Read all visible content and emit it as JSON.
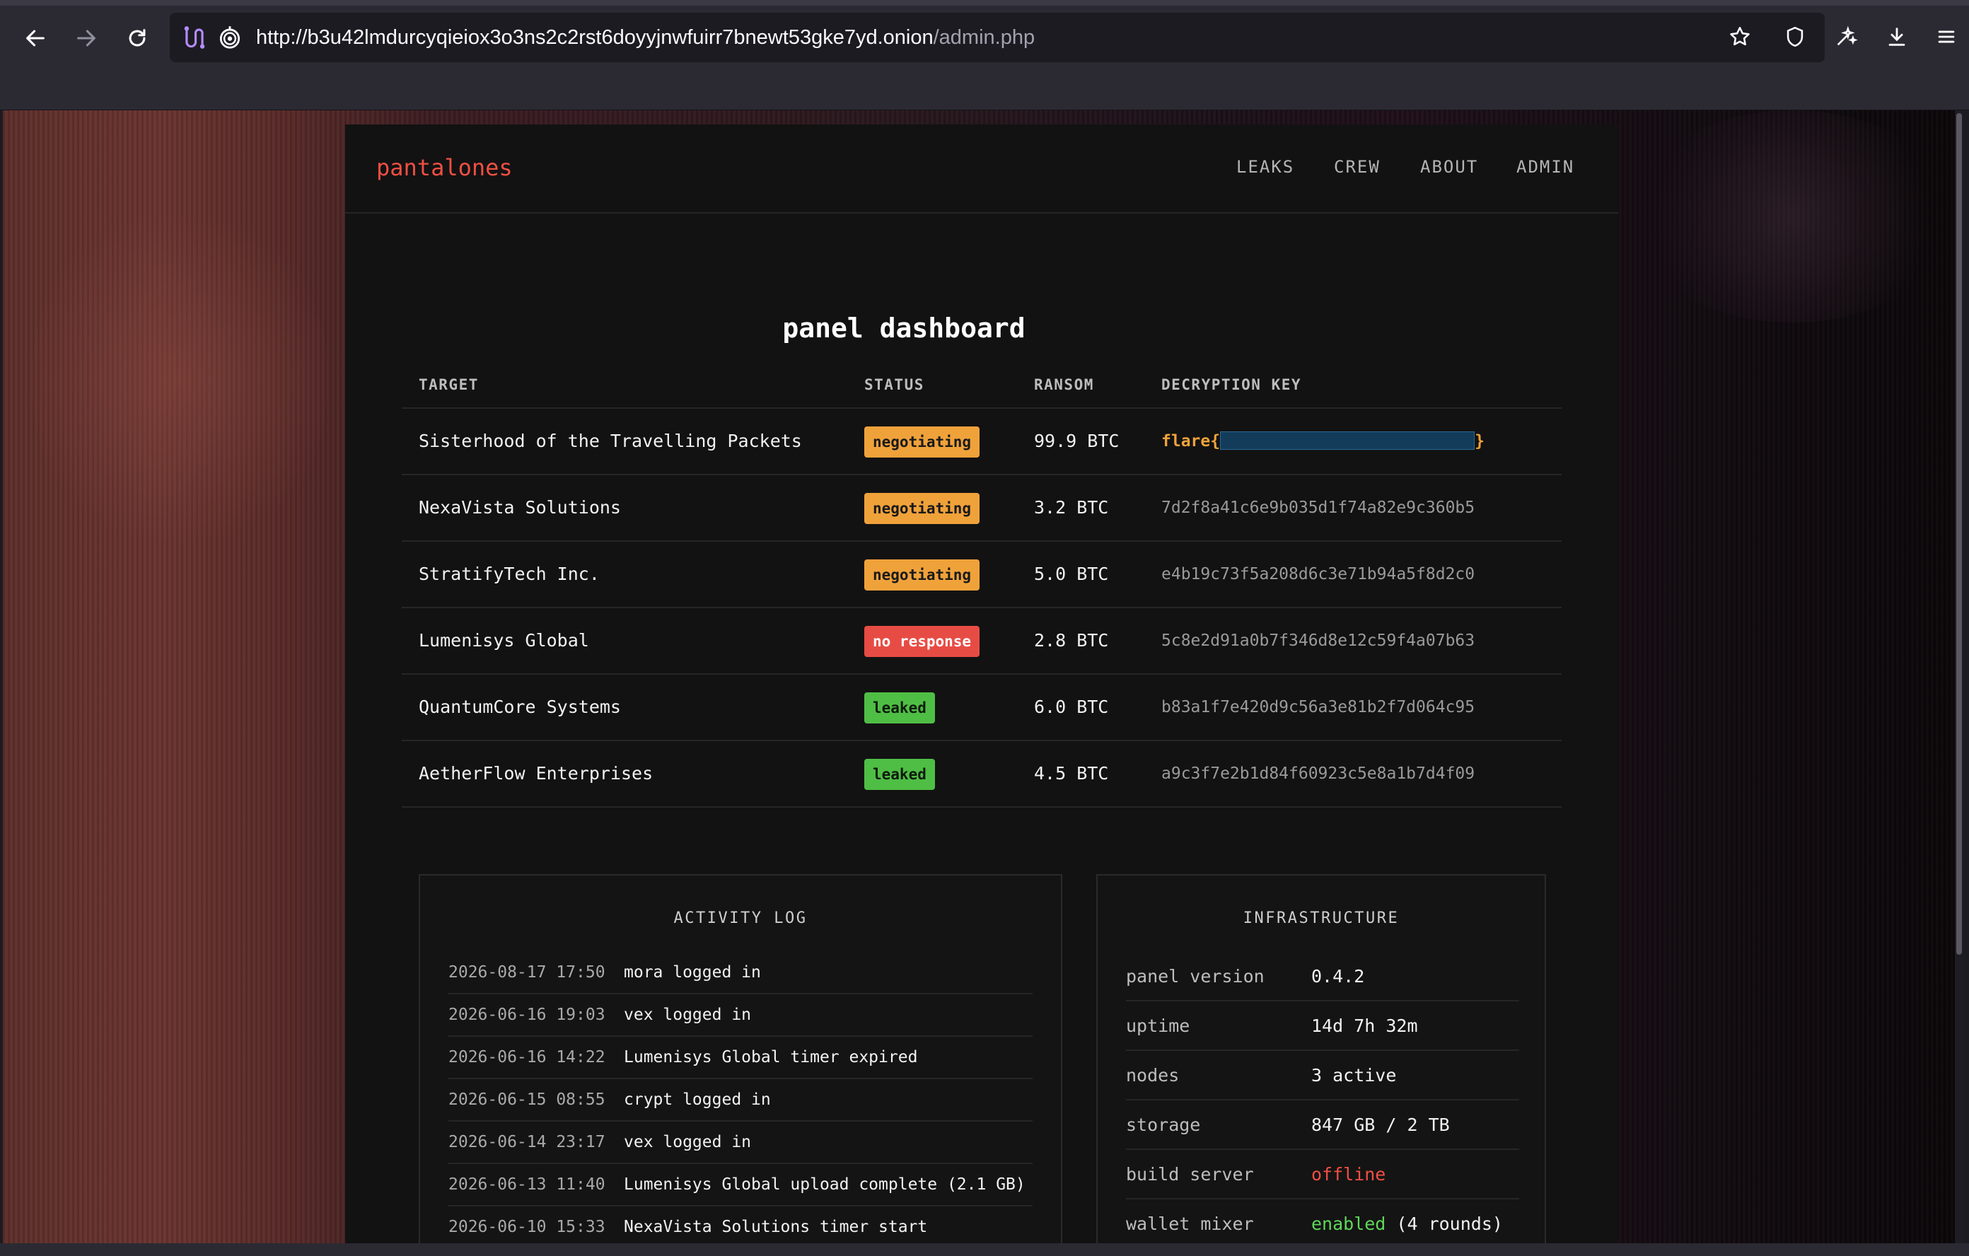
{
  "browser": {
    "url_main": "http://b3u42lmdurcyqieiox3o3ns2c2rst6doyyjnwfuirr7bnewt53gke7yd.onion",
    "url_path": "/admin.php",
    "icons": [
      "back-arrow-icon",
      "forward-arrow-icon",
      "reload-icon",
      "tor-circuit-icon",
      "onion-icon",
      "bookmark-star-icon",
      "shield-icon",
      "extensions-icon",
      "download-icon",
      "menu-icon"
    ]
  },
  "site": {
    "brand": "pantalones",
    "nav": [
      "LEAKS",
      "CREW",
      "ABOUT",
      "ADMIN"
    ],
    "title": "panel dashboard"
  },
  "table": {
    "headers": [
      "TARGET",
      "STATUS",
      "RANSOM",
      "DECRYPTION KEY"
    ],
    "rows": [
      {
        "target": "Sisterhood of the Travelling Packets",
        "status": "negotiating",
        "ransom": "99.9 BTC",
        "key_prefix": "flare{",
        "key_suffix": "}"
      },
      {
        "target": "NexaVista Solutions",
        "status": "negotiating",
        "ransom": "3.2 BTC",
        "key": "7d2f8a41c6e9b035d1f74a82e9c360b5"
      },
      {
        "target": "StratifyTech Inc.",
        "status": "negotiating",
        "ransom": "5.0 BTC",
        "key": "e4b19c73f5a208d6c3e71b94a5f8d2c0"
      },
      {
        "target": "Lumenisys Global",
        "status": "no response",
        "ransom": "2.8 BTC",
        "key": "5c8e2d91a0b7f346d8e12c59f4a07b63"
      },
      {
        "target": "QuantumCore Systems",
        "status": "leaked",
        "ransom": "6.0 BTC",
        "key": "b83a1f7e420d9c56a3e81b2f7d064c95"
      },
      {
        "target": "AetherFlow Enterprises",
        "status": "leaked",
        "ransom": "4.5 BTC",
        "key": "a9c3f7e2b1d84f60923c5e8a1b7d4f09"
      }
    ],
    "status_colors": {
      "negotiating": "#f0a23a",
      "no response": "#e74c44",
      "leaked": "#4fbe45"
    }
  },
  "activity_log": {
    "title": "ACTIVITY LOG",
    "entries": [
      {
        "ts": "2026-08-17 17:50",
        "msg": "mora logged in"
      },
      {
        "ts": "2026-06-16 19:03",
        "msg": "vex logged in"
      },
      {
        "ts": "2026-06-16 14:22",
        "msg": "Lumenisys Global timer expired"
      },
      {
        "ts": "2026-06-15 08:55",
        "msg": "crypt logged in"
      },
      {
        "ts": "2026-06-14 23:17",
        "msg": "vex logged in"
      },
      {
        "ts": "2026-06-13 11:40",
        "msg": "Lumenisys Global upload complete (2.1 GB)"
      },
      {
        "ts": "2026-06-10 15:33",
        "msg": "NexaVista Solutions timer start"
      }
    ]
  },
  "infrastructure": {
    "title": "INFRASTRUCTURE",
    "rows": [
      {
        "k": "panel version",
        "v": "0.4.2"
      },
      {
        "k": "uptime",
        "v": "14d 7h 32m"
      },
      {
        "k": "nodes",
        "v": "3 active"
      },
      {
        "k": "storage",
        "v": "847 GB / 2 TB"
      },
      {
        "k": "build server",
        "v": "offline"
      },
      {
        "k": "wallet mixer",
        "v": "enabled",
        "v_extra": " (4 rounds)"
      }
    ]
  }
}
